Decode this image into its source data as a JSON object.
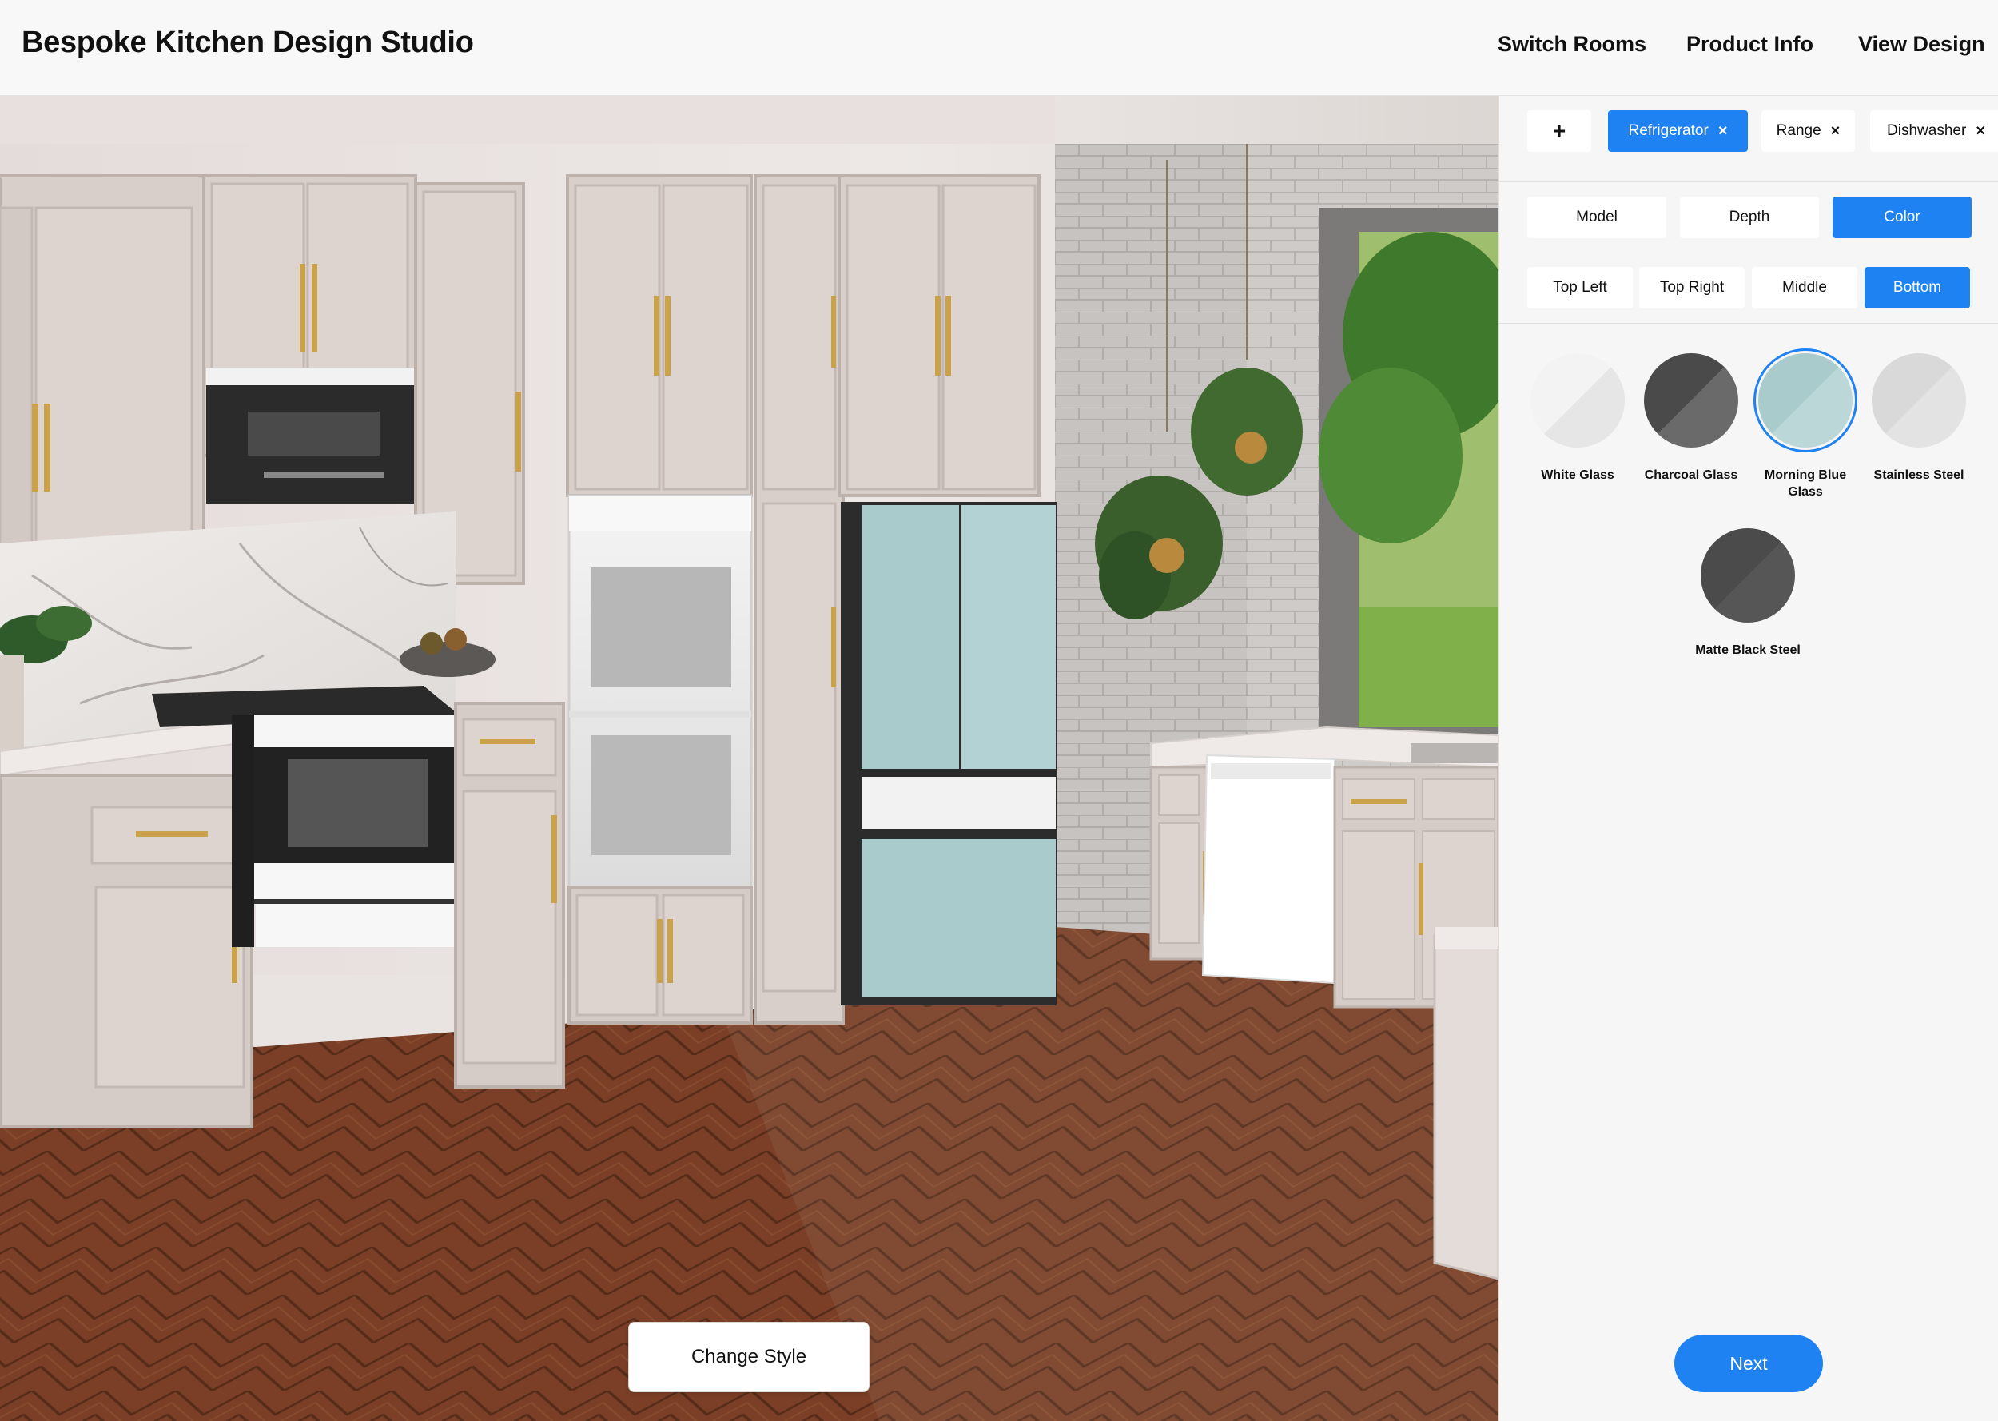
{
  "header": {
    "title": "Bespoke Kitchen Design Studio",
    "nav": [
      "Switch Rooms",
      "Product Info",
      "View Design"
    ]
  },
  "appliance_tabs": {
    "add_label": "+",
    "items": [
      {
        "label": "Refrigerator",
        "active": true
      },
      {
        "label": "Range",
        "active": false
      },
      {
        "label": "Dishwasher",
        "active": false
      }
    ],
    "remove_glyph": "×"
  },
  "option_tabs": [
    {
      "label": "Model",
      "active": false
    },
    {
      "label": "Depth",
      "active": false
    },
    {
      "label": "Color",
      "active": true
    }
  ],
  "panel_tabs": [
    {
      "label": "Top Left",
      "active": false
    },
    {
      "label": "Top Right",
      "active": false
    },
    {
      "label": "Middle",
      "active": false
    },
    {
      "label": "Bottom",
      "active": true
    }
  ],
  "swatches": [
    {
      "name": "White Glass",
      "color_a": "#f3f3f3",
      "color_b": "#e6e6e6",
      "selected": false
    },
    {
      "name": "Charcoal Glass",
      "color_a": "#4a4a4a",
      "color_b": "#6a6a6a",
      "selected": false
    },
    {
      "name": "Morning Blue Glass",
      "color_a": "#a9cbcc",
      "color_b": "#bcd7d8",
      "selected": true
    },
    {
      "name": "Stainless Steel",
      "color_a": "#d9d9d9",
      "color_b": "#e3e3e3",
      "selected": false
    },
    {
      "name": "Matte Black Steel",
      "color_a": "#4b4b4b",
      "color_b": "#565656",
      "selected": false
    }
  ],
  "scene": {
    "change_style_label": "Change Style",
    "colors": {
      "wall": "#e9e4e2",
      "cabinet": "#d9cfcb",
      "cabinet_shade": "#c5b9b4",
      "brick": "#c9c6c3",
      "marble": "#ece7e6",
      "floor": "#8b4a2a",
      "floor_dark": "#6e3a20",
      "fridge_blue": "#a9cbcc",
      "handle_gold": "#c9a24a"
    }
  },
  "next_label": "Next",
  "accent_color": "#1f82f2"
}
